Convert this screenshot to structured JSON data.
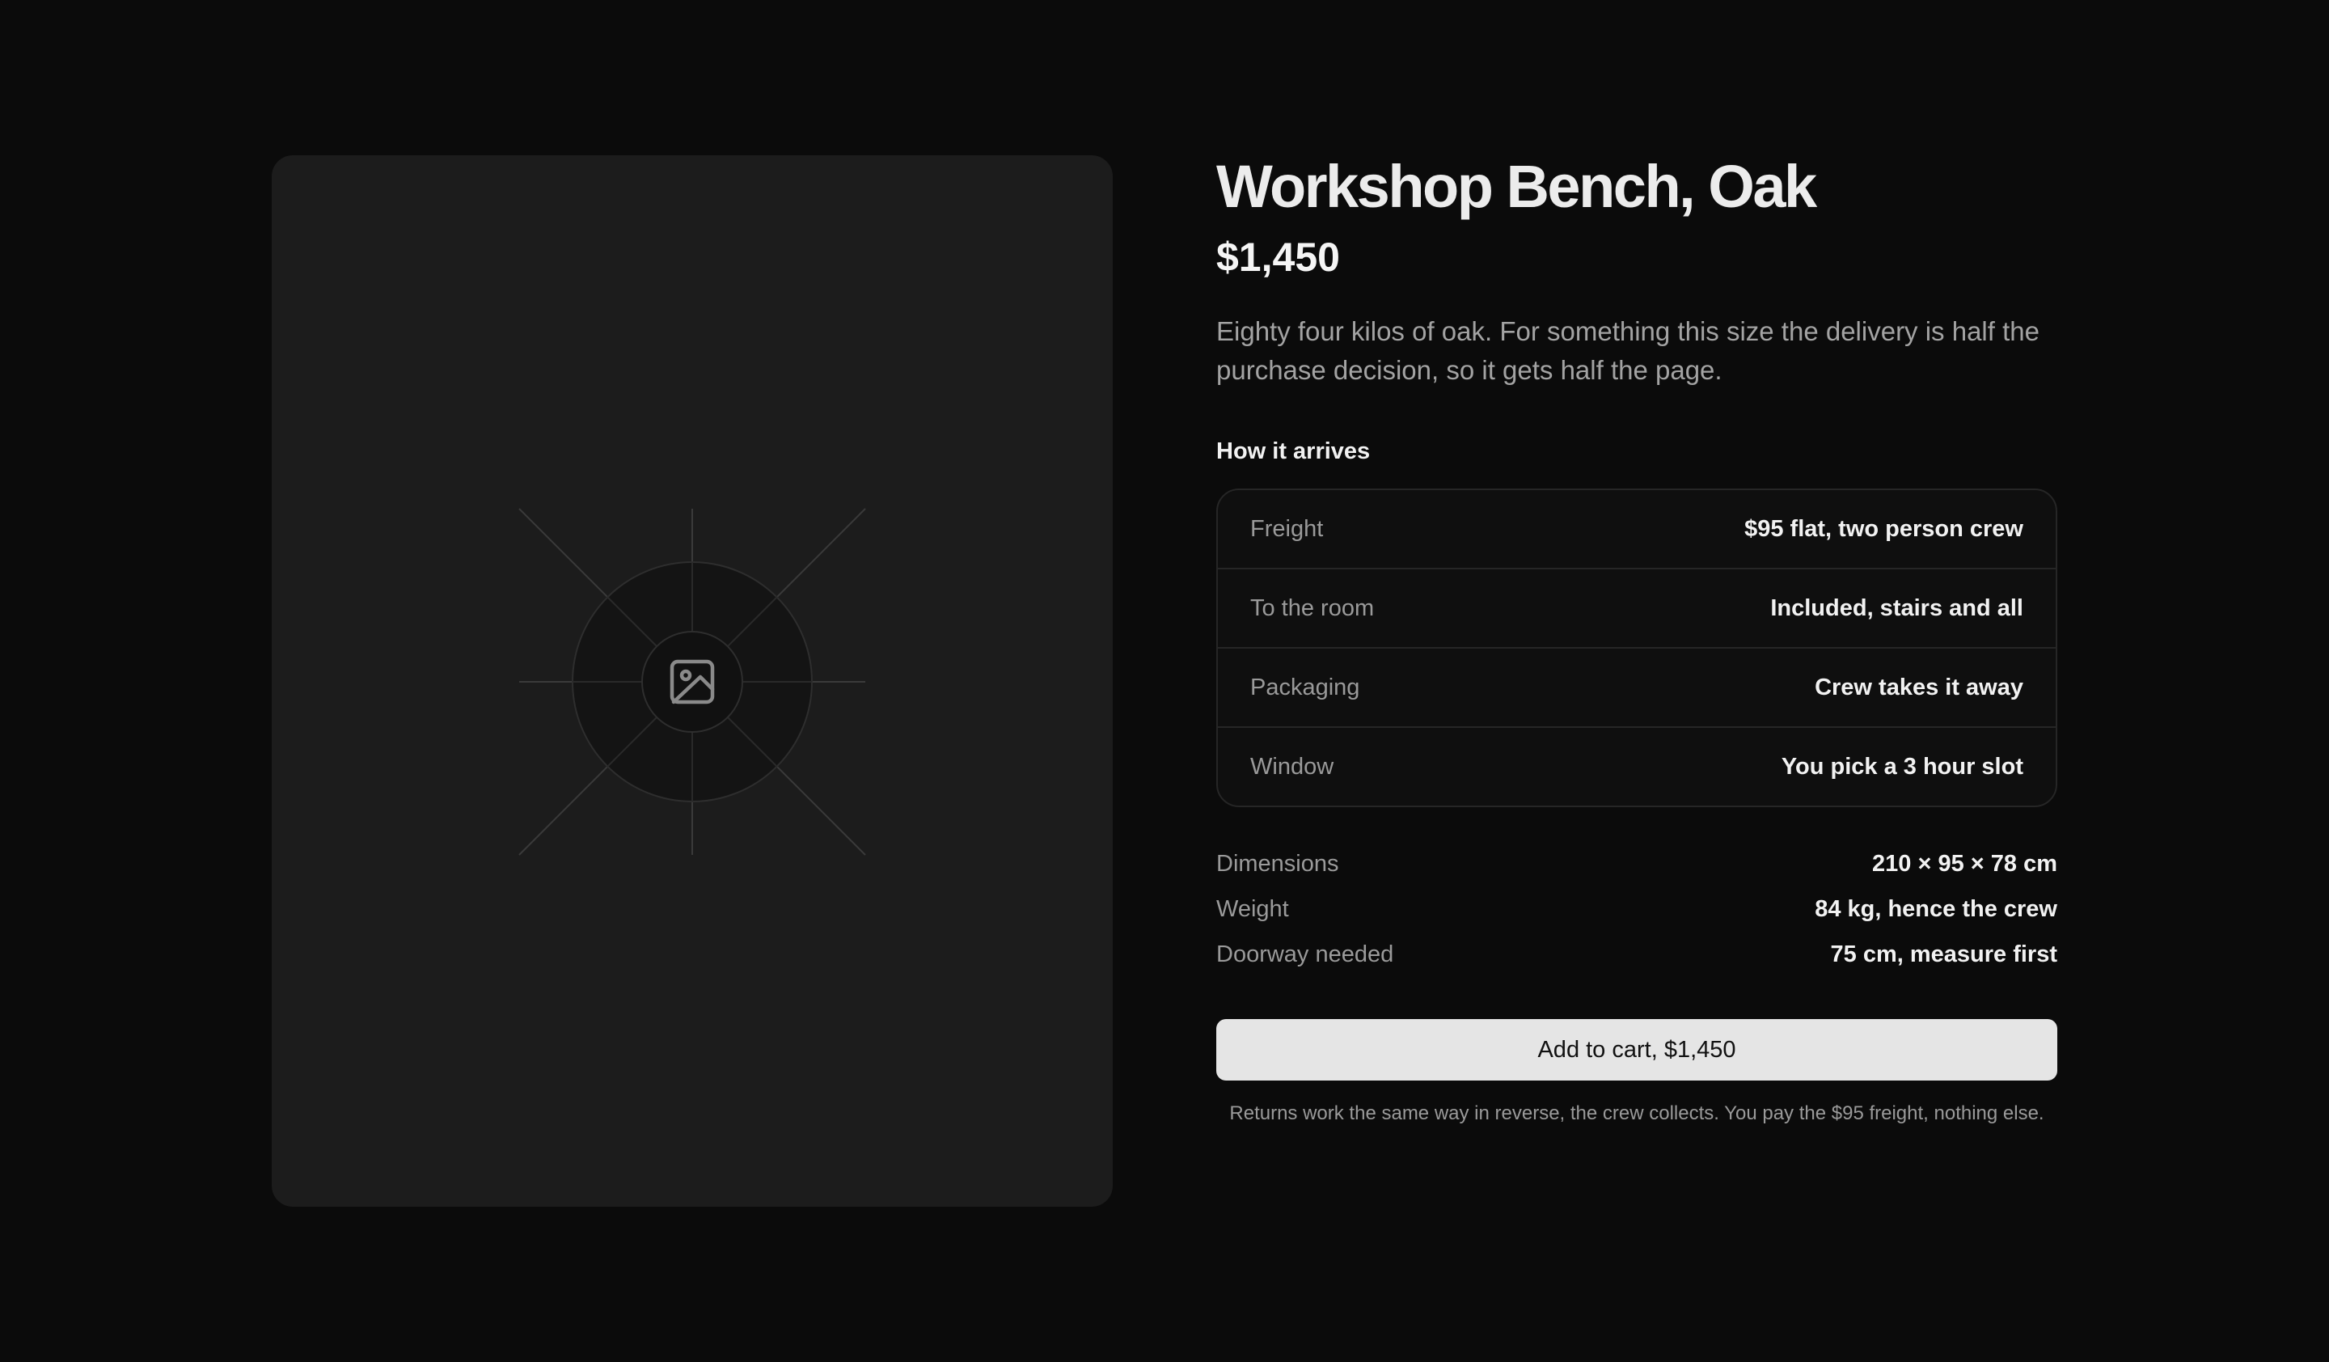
{
  "product": {
    "title": "Workshop Bench, Oak",
    "price": "$1,450",
    "description": "Eighty four kilos of oak. For something this size the delivery is half the purchase decision, so it gets half the page.",
    "image_icon": "image-placeholder-icon"
  },
  "arrival": {
    "heading": "How it arrives",
    "rows": [
      {
        "label": "Freight",
        "value": "$95 flat, two person crew"
      },
      {
        "label": "To the room",
        "value": "Included, stairs and all"
      },
      {
        "label": "Packaging",
        "value": "Crew takes it away"
      },
      {
        "label": "Window",
        "value": "You pick a 3 hour slot"
      }
    ]
  },
  "specs": [
    {
      "label": "Dimensions",
      "value": "210 × 95 × 78 cm"
    },
    {
      "label": "Weight",
      "value": "84 kg, hence the crew"
    },
    {
      "label": "Doorway needed",
      "value": "75 cm, measure first"
    }
  ],
  "cart": {
    "button_label": "Add to cart, $1,450",
    "returns_note": "Returns work the same way in reverse, the crew collects. You pay the $95 freight, nothing else."
  },
  "colors": {
    "background": "#0b0b0b",
    "card": "#1c1c1c",
    "button": "#e5e5e5",
    "muted_text": "#9a9a9a"
  }
}
